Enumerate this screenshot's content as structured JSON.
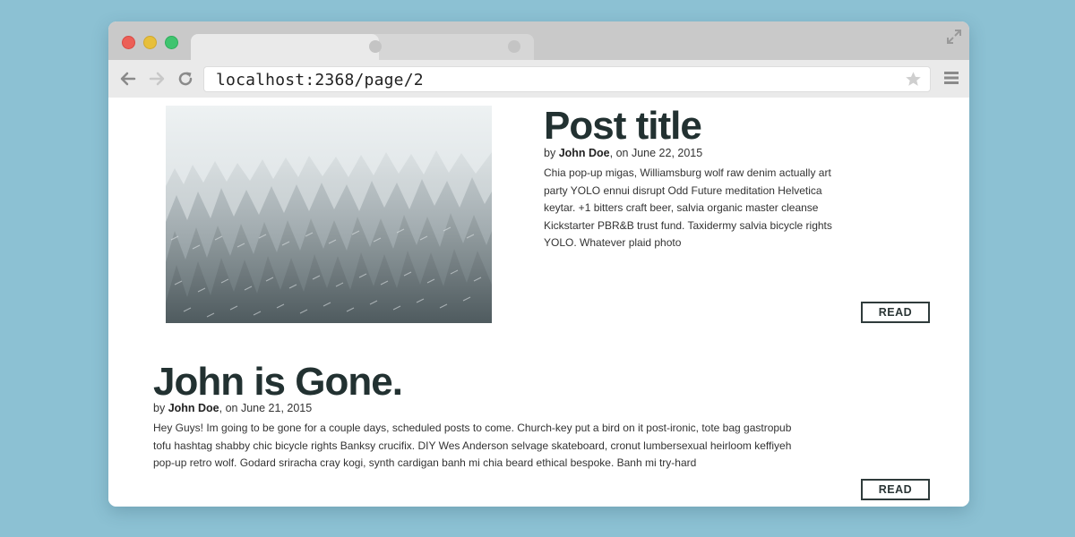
{
  "browser": {
    "url": "localhost:2368/page/2"
  },
  "posts": [
    {
      "title": "Post title",
      "by": "by ",
      "author": "John Doe",
      "date_text": ", on June 22, 2015",
      "excerpt": "Chia pop-up migas, Williamsburg wolf raw denim actually art party YOLO ennui disrupt Odd Future meditation Helvetica keytar. +1 bitters craft beer, salvia organic master cleanse Kickstarter PBR&B trust fund. Taxidermy salvia bicycle rights YOLO. Whatever plaid photo",
      "read_label": "READ"
    },
    {
      "title": "John is Gone.",
      "by": "by ",
      "author": "John Doe",
      "date_text": ", on June 21, 2015",
      "excerpt": "Hey Guys! Im going to be gone for a couple days, scheduled posts to come. Church-key put a bird on it post-ironic, tote bag gastropub tofu hashtag shabby chic bicycle rights Banksy crucifix. DIY Wes Anderson selvage skateboard, cronut lumbersexual heirloom keffiyeh pop-up retro wolf. Godard sriracha cray kogi, synth cardigan banh mi chia beard ethical bespoke. Banh mi try-hard",
      "read_label": "READ"
    }
  ],
  "colors": {
    "background": "#8cc1d3",
    "title_text": "#223131"
  },
  "icons": [
    "close-dot",
    "minimize-dot",
    "maximize-dot",
    "expand-icon",
    "back-arrow-icon",
    "forward-arrow-icon",
    "reload-icon",
    "star-icon",
    "menu-icon"
  ]
}
